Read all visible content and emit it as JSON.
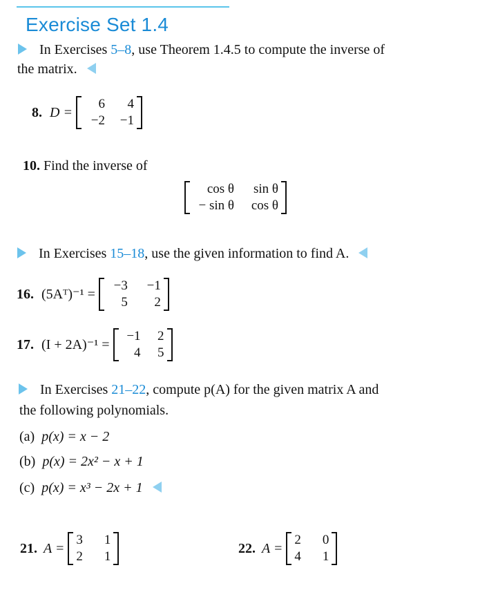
{
  "section": {
    "title": "Exercise Set 1.4",
    "accent_color": "#1a8bd6"
  },
  "instr1": {
    "prefix": "In Exercises ",
    "link": "5–8",
    "suffix_line1": ", use Theorem 1.4.5 to compute the inverse of",
    "line2": "the matrix."
  },
  "ex8": {
    "number": "8.",
    "lhs": "D =",
    "matrix": [
      [
        "6",
        "4"
      ],
      [
        "−2",
        "−1"
      ]
    ]
  },
  "ex10": {
    "number": "10.",
    "text": "Find the inverse of",
    "matrix": [
      [
        "cos θ",
        "sin θ"
      ],
      [
        "− sin θ",
        "cos θ"
      ]
    ]
  },
  "instr2": {
    "prefix": "In Exercises ",
    "link": "15–18",
    "suffix": ", use the given information to find A."
  },
  "ex16": {
    "number": "16.",
    "lhs": "(5Aᵀ)⁻¹ =",
    "matrix": [
      [
        "−3",
        "−1"
      ],
      [
        "5",
        "2"
      ]
    ]
  },
  "ex17": {
    "number": "17.",
    "lhs": "(I + 2A)⁻¹ =",
    "matrix": [
      [
        "−1",
        "2"
      ],
      [
        "4",
        "5"
      ]
    ]
  },
  "instr3": {
    "prefix": "In Exercises ",
    "link": "21–22",
    "suffix_line1": ", compute p(A) for the given matrix A and",
    "line2": "the following polynomials."
  },
  "polys": [
    {
      "label": "(a)",
      "expr": "p(x) = x − 2"
    },
    {
      "label": "(b)",
      "expr": "p(x) = 2x² − x + 1"
    },
    {
      "label": "(c)",
      "expr": "p(x) = x³ − 2x + 1"
    }
  ],
  "ex21": {
    "number": "21.",
    "lhs": "A =",
    "matrix": [
      [
        "3",
        "1"
      ],
      [
        "2",
        "1"
      ]
    ]
  },
  "ex22": {
    "number": "22.",
    "lhs": "A =",
    "matrix": [
      [
        "2",
        "0"
      ],
      [
        "4",
        "1"
      ]
    ]
  }
}
